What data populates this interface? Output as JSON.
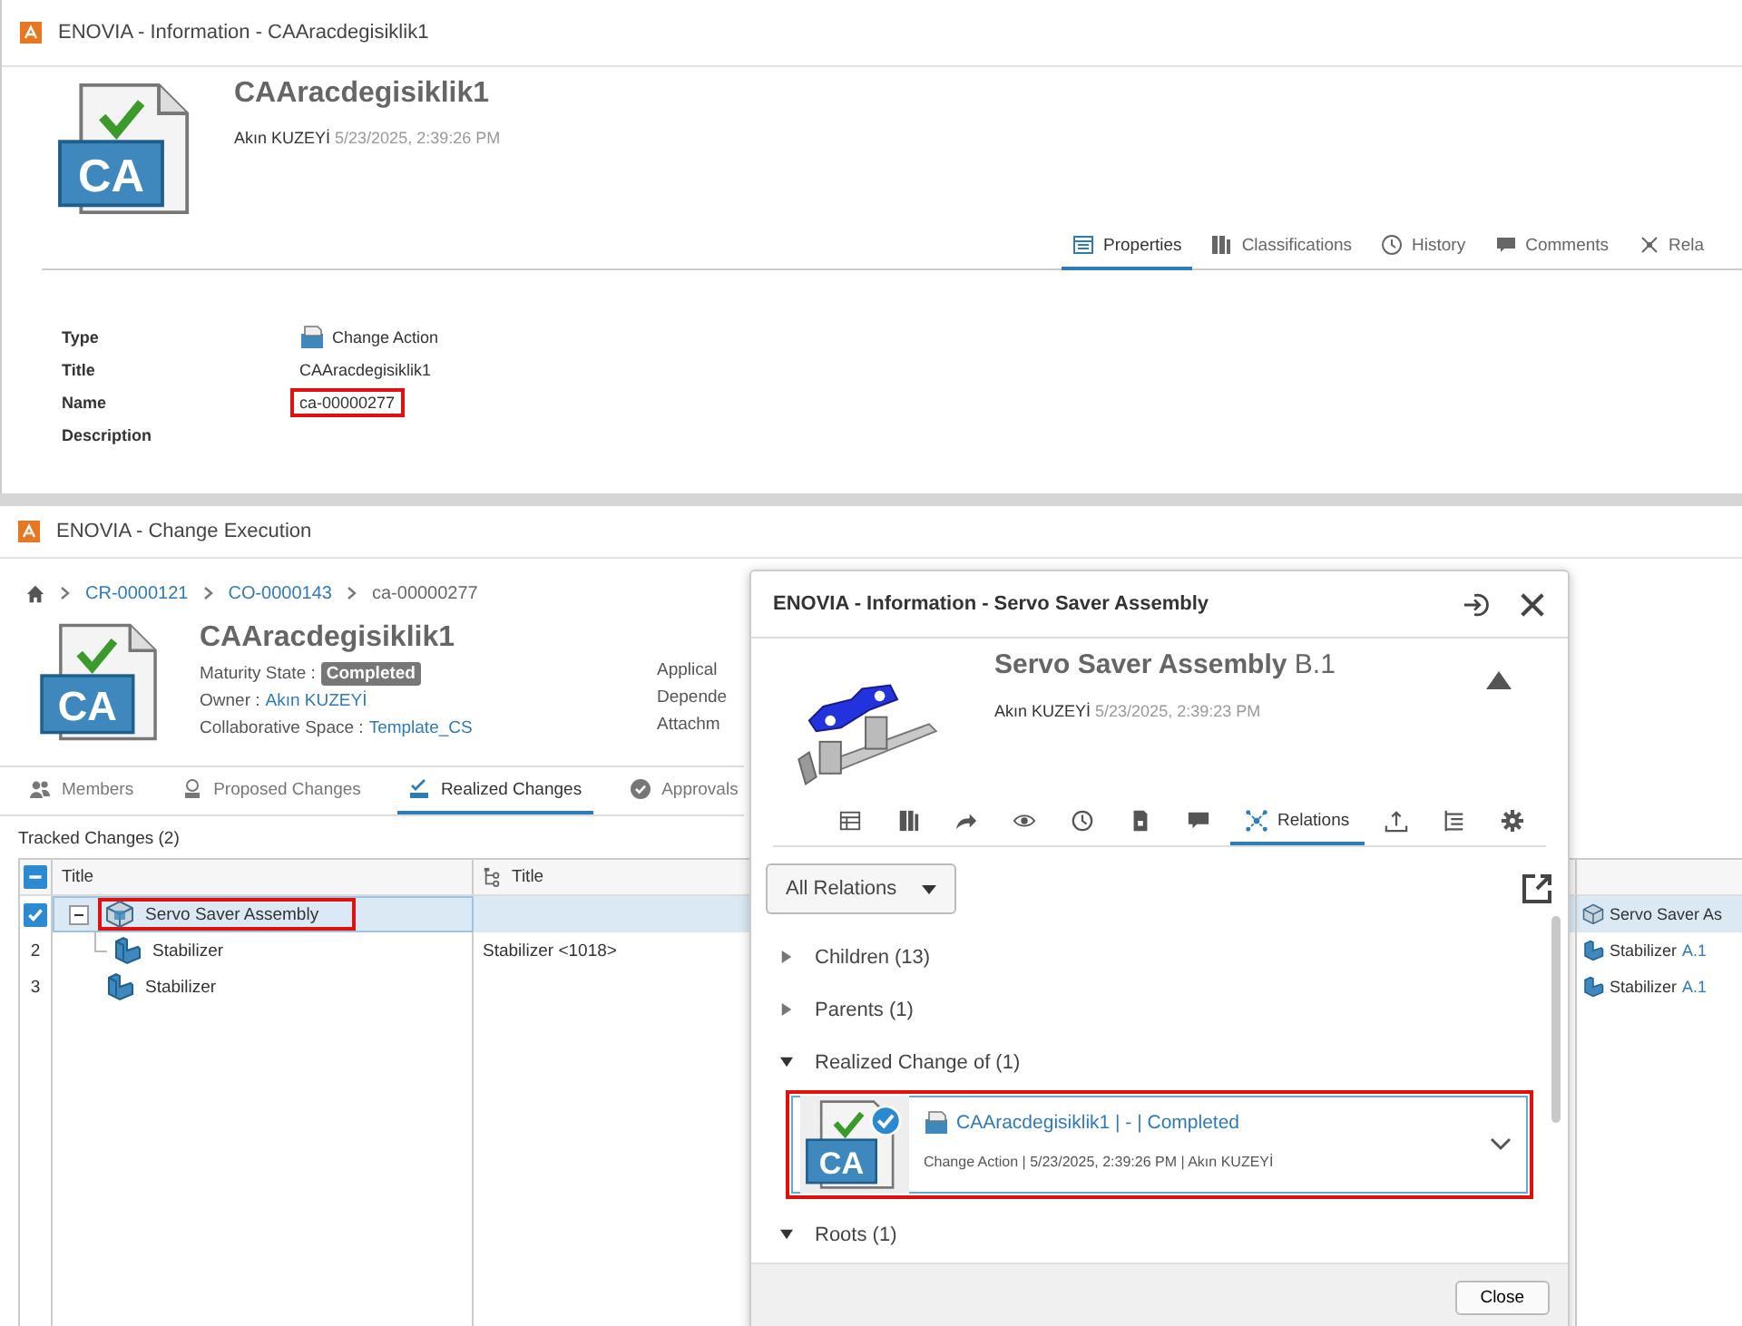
{
  "info_window": {
    "title": "ENOVIA - Information - CAAracdegisiklik1",
    "header": {
      "badge": "CA",
      "name": "CAAracdegisiklik1",
      "author": "Akın  KUZEYİ",
      "date": "5/23/2025, 2:39:26 PM"
    },
    "tabs": [
      {
        "kind": "properties",
        "label": "Properties",
        "selected": true
      },
      {
        "kind": "classifications",
        "label": "Classifications",
        "selected": false
      },
      {
        "kind": "history",
        "label": "History",
        "selected": false
      },
      {
        "kind": "comments",
        "label": "Comments",
        "selected": false
      },
      {
        "kind": "relations",
        "label": "Rela",
        "selected": false
      }
    ],
    "properties": [
      {
        "label": "Type",
        "value": "Change Action",
        "kind": "type"
      },
      {
        "label": "Title",
        "value": "CAAracdegisiklik1",
        "kind": "text"
      },
      {
        "label": "Name",
        "value": "ca-00000277",
        "kind": "text",
        "highlighted": true
      },
      {
        "label": "Description"
      }
    ]
  },
  "execution_window": {
    "title": "ENOVIA - Change Execution",
    "breadcrumb": [
      {
        "label": "CR-0000121",
        "current": false
      },
      {
        "label": "CO-0000143",
        "current": false
      },
      {
        "label": "ca-00000277",
        "current": true
      }
    ],
    "header": {
      "badge": "CA",
      "name": "CAAracdegisiklik1",
      "maturity_label": "Maturity State :",
      "maturity": "Completed",
      "owner_label": "Owner :",
      "owner": "Akın KUZEYİ",
      "space_label": "Collaborative Space :",
      "space": "Template_CS"
    },
    "side_labels": [
      "Applical",
      "Depende",
      "Attachm"
    ],
    "tabs": [
      {
        "kind": "members",
        "label": "Members",
        "selected": false
      },
      {
        "kind": "proposed",
        "label": "Proposed Changes",
        "selected": false
      },
      {
        "kind": "realized",
        "label": "Realized Changes",
        "selected": true
      },
      {
        "kind": "approvals",
        "label": "Approvals",
        "selected": false
      }
    ],
    "tracked_label": "Tracked Changes (2)",
    "table": {
      "select_all_indeterminate": true,
      "columns": [
        "Title",
        "Title"
      ],
      "rows": [
        {
          "checked": true,
          "selected": true,
          "kind": "assembly",
          "title": "Servo Saver Assembly",
          "highlighted": true,
          "expanded": true,
          "column_3": "Servo Saver As",
          "children": [
            {
              "number": "2",
              "checked": false,
              "selected": false,
              "kind": "part",
              "title": "Stabilizer",
              "highlighted": false,
              "column_2": "Stabilizer <1018>",
              "column_3": "Stabilizer",
              "revision": "A.1"
            }
          ]
        },
        {
          "number": "3",
          "checked": false,
          "selected": false,
          "kind": "part",
          "title": "Stabilizer",
          "highlighted": false,
          "column_3": "Stabilizer",
          "revision": "A.1"
        }
      ]
    }
  },
  "dialog": {
    "title": "ENOVIA - Information - Servo Saver Assembly",
    "header": {
      "name": "Servo Saver Assembly",
      "revision": "B.1",
      "author": "Akın  KUZEYİ",
      "date": "5/23/2025, 2:39:23 PM"
    },
    "tabs": [
      {
        "kind": "table",
        "selected": false
      },
      {
        "kind": "classification",
        "selected": false
      },
      {
        "kind": "share",
        "selected": false
      },
      {
        "kind": "eye",
        "selected": false
      },
      {
        "kind": "clock",
        "selected": false
      },
      {
        "kind": "lock-document",
        "selected": false
      },
      {
        "kind": "comment",
        "selected": false
      },
      {
        "kind": "relations",
        "label": "Relations",
        "selected": true
      },
      {
        "kind": "upload",
        "selected": false
      },
      {
        "kind": "list",
        "selected": false
      },
      {
        "kind": "gear",
        "selected": false
      }
    ],
    "filter": "All Relations",
    "sections": [
      {
        "label": "Children (13)",
        "expanded": false
      },
      {
        "label": "Parents (1)",
        "expanded": false
      },
      {
        "label": "Realized Change of (1)",
        "expanded": true,
        "cards": [
          {
            "badge": "CA",
            "title": "CAAracdegisiklik1 | - | Completed",
            "meta": "Change Action | 5/23/2025, 2:39:26 PM | Akın KUZEYİ",
            "highlighted": true
          }
        ]
      },
      {
        "label": "Roots (1)",
        "expanded": true
      }
    ],
    "close_button": "Close"
  }
}
